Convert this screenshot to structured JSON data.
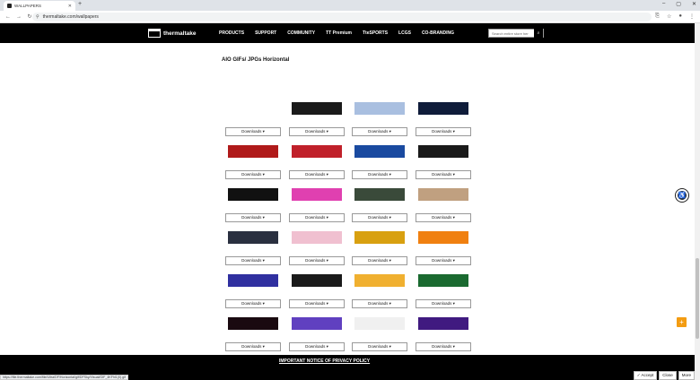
{
  "browser": {
    "tab_title": "WALLPAPERS",
    "url": "thermaltake.com/wallpapers"
  },
  "header": {
    "logo_text": "thermaltake",
    "menu": [
      "PRODUCTS",
      "SUPPORT",
      "COMMUNITY",
      "TT Premium",
      "TteSPORTS",
      "LCGS",
      "CO-BRANDING"
    ],
    "search_placeholder": "Search entire store her"
  },
  "section": {
    "title": "AIO GIFs/ JPGs Horizontal"
  },
  "download_label": "Downloads ▾",
  "thumbnails": [
    [
      "#ffffff",
      "#1a1a1a",
      "#a9bfe0",
      "#0f1c3a"
    ],
    [
      "#b01a1a",
      "#c0202a",
      "#1a4aa0",
      "#1a1a1a"
    ],
    [
      "#111111",
      "#e040b0",
      "#3a4a3a",
      "#c0a080"
    ],
    [
      "#2a3040",
      "#f0c0d0",
      "#d8a010",
      "#f08010"
    ],
    [
      "#3030a0",
      "#1a1a1a",
      "#f0b030",
      "#1a6a30"
    ],
    [
      "#1a0a10",
      "#6040c0",
      "#f0f0f0",
      "#401a80"
    ],
    [
      "#0a0a0a",
      "#000000",
      "#ffffff",
      "#000000"
    ]
  ],
  "privacy": {
    "notice": "IMPORTANT NOTICE OF PRIVACY POLICY",
    "accept": "✓ Accept",
    "close": "Close",
    "more": "More"
  },
  "status_url": "https://file.thermaltake.com/file/Ultra/DF/Horizontal/gif/DFSky/Visual/GIF_4KFhl1(0).gif"
}
